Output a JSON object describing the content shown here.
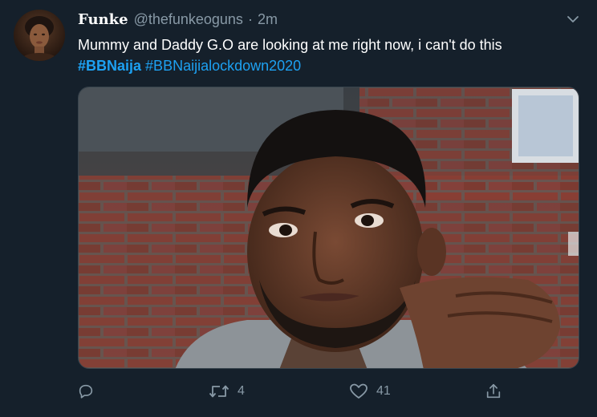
{
  "tweet": {
    "display_name": "Funke",
    "handle": "@thefunkeoguns",
    "separator": "·",
    "time": "2m",
    "text": "Mummy and Daddy G.O are looking at me right now, i can't do this",
    "hashtags": [
      "#BBNaija",
      "#BBNaijialockdown2020"
    ]
  },
  "actions": {
    "reply_count": "",
    "retweet_count": "4",
    "like_count": "41"
  },
  "icons": {
    "caret": "chevron-down-icon",
    "reply": "reply-icon",
    "retweet": "retweet-icon",
    "like": "heart-icon",
    "share": "share-icon"
  },
  "colors": {
    "background": "#15202b",
    "text": "#ffffff",
    "muted": "#8899a6",
    "link": "#1da1f2",
    "border": "#38444d"
  }
}
